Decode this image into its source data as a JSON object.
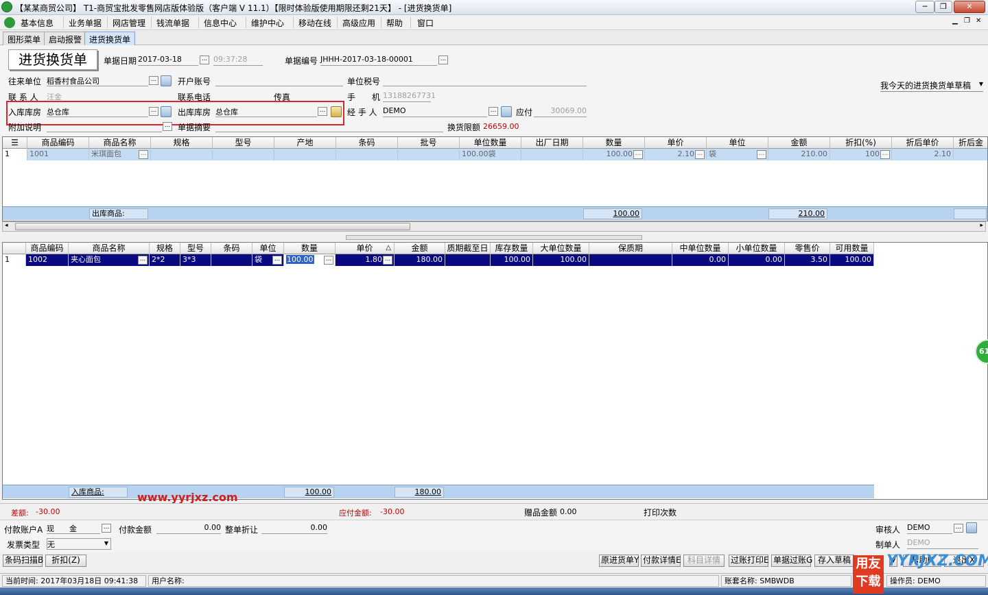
{
  "window": {
    "title": "【某某商贸公司】 T1-商贸宝批发零售网店版体验版（客户端 V 11.1）【限时体验版使用期限还剩21天】 - [进货换货单]",
    "buttons": {
      "minimize": "─",
      "restore": "❐",
      "close": "✕"
    }
  },
  "menu": {
    "items": [
      "基本信息",
      "业务单据",
      "网店管理",
      "钱流单据",
      "信息中心",
      "维护中心",
      "移动在线",
      "高级应用",
      "帮助",
      "窗口"
    ],
    "mdi_buttons": {
      "minimize": "▁",
      "restore": "❐",
      "close": "✕"
    }
  },
  "tabs": [
    "图形菜单",
    "启动报警",
    "进货换货单"
  ],
  "form": {
    "doc_title": "进货换货单",
    "date_label": "单据日期",
    "date": "2017-03-18",
    "time": "09:37:28",
    "docno_label": "单据编号",
    "docno": "JHHH-2017-03-18-00001",
    "partner_label": "往来单位",
    "partner": "稻香村食品公司",
    "account_label": "开户账号",
    "taxno_label": "单位税号",
    "contact_label": "联 系 人",
    "contact": "汪金",
    "phone_label": "联系电话",
    "fax_label": "传真",
    "mobile_label": "手　　机",
    "mobile": "13188267731",
    "in_store_label": "入库库房",
    "in_store": "总仓库",
    "out_store_label": "出库库房",
    "out_store": "总仓库",
    "handler_label": "经 手 人",
    "handler": "DEMO",
    "payable_label": "应付",
    "payable": "30069.00",
    "note_label": "附加说明",
    "summary_label": "单据摘要",
    "limit_label": "换货限额",
    "limit": "26659.00",
    "draft_combo": "我今天的进货换货单草稿"
  },
  "out_grid": {
    "headers": [
      "商品编码",
      "商品名称",
      "规格",
      "型号",
      "产地",
      "条码",
      "批号",
      "单位数量",
      "出厂日期",
      "数量",
      "单价",
      "单位",
      "金额",
      "折扣(%)",
      "折后单价",
      "折后金"
    ],
    "rows": [
      {
        "idx": "1",
        "code": "1001",
        "name": "米琪面包",
        "unit_qty": "100.00袋",
        "qty": "100.00",
        "price": "2.10",
        "unit": "袋",
        "amount": "210.00",
        "discount": "100",
        "disc_price": "2.10"
      }
    ],
    "footer": {
      "label": "出库商品:",
      "qty": "100.00",
      "amount": "210.00"
    }
  },
  "in_grid": {
    "headers": [
      "商品编码",
      "商品名称",
      "规格",
      "型号",
      "条码",
      "单位",
      "数量",
      "单价",
      "金额",
      "质期截至日",
      "库存数量",
      "大单位数量",
      "保质期",
      "中单位数量",
      "小单位数量",
      "零售价",
      "可用数量"
    ],
    "price_sort_mark": "△",
    "rows": [
      {
        "idx": "1",
        "code": "1002",
        "name": "夹心面包",
        "spec": "2*2",
        "model": "3*3",
        "unit": "袋",
        "qty": "100.00",
        "price": "1.80",
        "amount": "180.00",
        "stock": "100.00",
        "big_unit_qty": "100.00",
        "mid_unit_qty": "0.00",
        "small_unit_qty": "0.00",
        "retail": "3.50",
        "available": "100.00"
      }
    ],
    "footer": {
      "label": "入库商品:",
      "qty": "100.00",
      "amount": "180.00"
    }
  },
  "summary": {
    "diff_label": "差额:",
    "diff": "-30.00",
    "payable_total_label": "应付金额:",
    "payable_total": "-30.00",
    "gift_label": "赠品金额",
    "gift": "0.00",
    "print_label": "打印次数"
  },
  "payment": {
    "account_label": "付款账户A",
    "account": "现　　金",
    "amount_label": "付款金额",
    "amount": "0.00",
    "discount_label": "整单折让",
    "discount": "0.00",
    "invoice_label": "发票类型",
    "invoice": "无",
    "auditor_label": "审核人",
    "auditor": "DEMO",
    "maker_label": "制单人",
    "maker": "DEMO"
  },
  "buttons": {
    "barcode": "条码扫描B",
    "discount": "折扣(Z)",
    "orig_doc": "原进货单Y",
    "pay_detail": "付款详情E",
    "subject_detail": "科目详情",
    "post_print": "过账打印E",
    "post": "单据过账G",
    "save_draft": "存入草稿",
    "help": "帮助H",
    "exit": "退出X"
  },
  "status": {
    "time_label": "当前时间:",
    "time": "2017年03月18日 09:41:38",
    "user_label": "用户名称:",
    "set_label": "账套名称:",
    "set": "SMBWDB",
    "operator_label": "操作员:",
    "operator": "DEMO"
  },
  "overlay": {
    "watermark": "www.yyrjxz.com",
    "logo_line1": "用友",
    "logo_line2": "下载",
    "logo_site": "YYRJXZ.COM",
    "bubble": "61"
  }
}
